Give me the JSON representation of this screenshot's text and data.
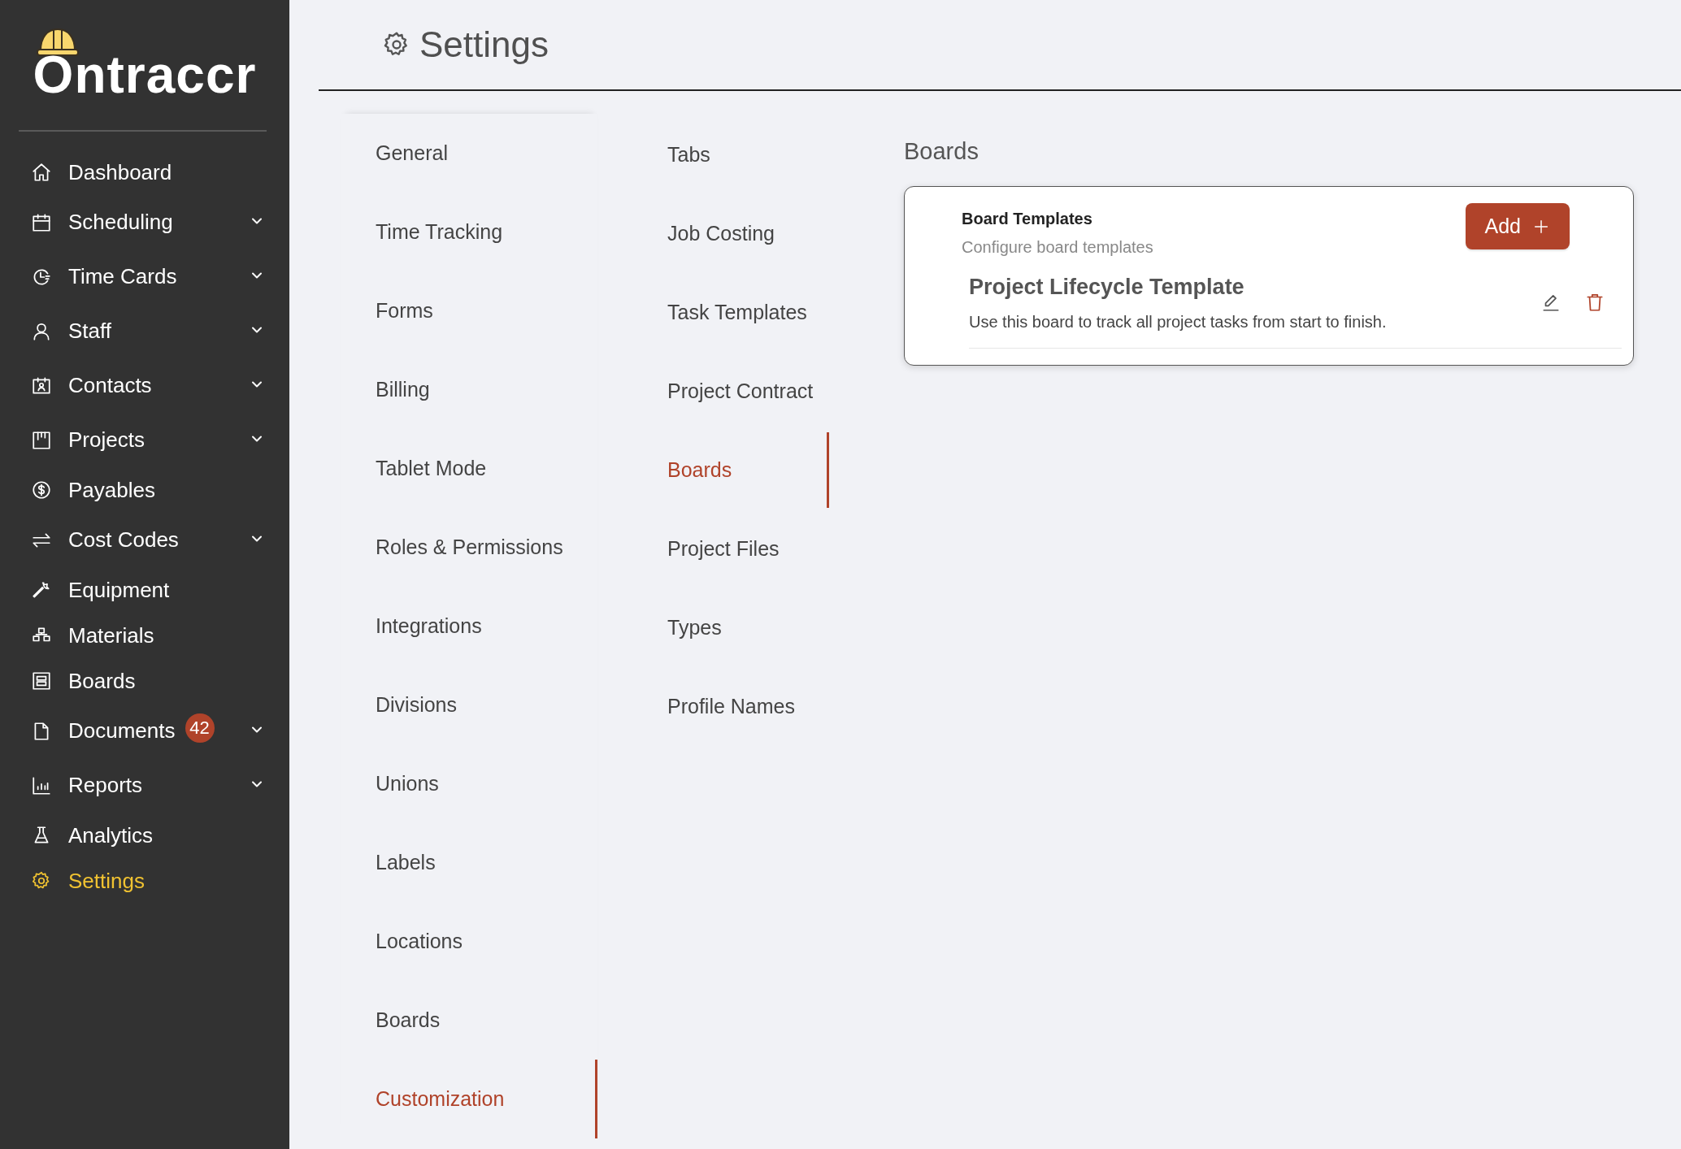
{
  "logo": {
    "text": "Ontraccr"
  },
  "sidebar": {
    "items": [
      {
        "label": "Dashboard",
        "has_submenu": false,
        "selected": false
      },
      {
        "label": "Scheduling",
        "has_submenu": true,
        "selected": false
      },
      {
        "label": "Time Cards",
        "has_submenu": true,
        "selected": false
      },
      {
        "label": "Staff",
        "has_submenu": true,
        "selected": false
      },
      {
        "label": "Contacts",
        "has_submenu": true,
        "selected": false
      },
      {
        "label": "Projects",
        "has_submenu": true,
        "selected": false
      },
      {
        "label": "Payables",
        "has_submenu": false,
        "selected": false
      },
      {
        "label": "Cost Codes",
        "has_submenu": true,
        "selected": false
      },
      {
        "label": "Equipment",
        "has_submenu": false,
        "selected": false
      },
      {
        "label": "Materials",
        "has_submenu": false,
        "selected": false
      },
      {
        "label": "Boards",
        "has_submenu": false,
        "selected": false
      },
      {
        "label": "Documents",
        "has_submenu": true,
        "selected": false,
        "badge": "42"
      },
      {
        "label": "Reports",
        "has_submenu": true,
        "selected": false
      },
      {
        "label": "Analytics",
        "has_submenu": false,
        "selected": false
      },
      {
        "label": "Settings",
        "has_submenu": false,
        "selected": true
      }
    ]
  },
  "page": {
    "title": "Settings"
  },
  "settings_menu": [
    {
      "label": "General",
      "selected": false
    },
    {
      "label": "Time Tracking",
      "selected": false
    },
    {
      "label": "Forms",
      "selected": false
    },
    {
      "label": "Billing",
      "selected": false
    },
    {
      "label": "Tablet Mode",
      "selected": false
    },
    {
      "label": "Roles & Permissions",
      "selected": false
    },
    {
      "label": "Integrations",
      "selected": false
    },
    {
      "label": "Divisions",
      "selected": false
    },
    {
      "label": "Unions",
      "selected": false
    },
    {
      "label": "Labels",
      "selected": false
    },
    {
      "label": "Locations",
      "selected": false
    },
    {
      "label": "Boards",
      "selected": false
    },
    {
      "label": "Customization",
      "selected": true
    }
  ],
  "sub_menu": [
    {
      "label": "Tabs",
      "selected": false
    },
    {
      "label": "Job Costing",
      "selected": false
    },
    {
      "label": "Task Templates",
      "selected": false
    },
    {
      "label": "Project Contract",
      "selected": false
    },
    {
      "label": "Boards",
      "selected": true
    },
    {
      "label": "Project Files",
      "selected": false
    },
    {
      "label": "Types",
      "selected": false
    },
    {
      "label": "Profile Names",
      "selected": false
    }
  ],
  "content": {
    "heading": "Boards",
    "card": {
      "title": "Board Templates",
      "subtitle": "Configure board templates",
      "add_button": "Add",
      "templates": [
        {
          "name": "Project Lifecycle Template",
          "description": "Use this board to track all project tasks from start to finish."
        }
      ]
    }
  }
}
